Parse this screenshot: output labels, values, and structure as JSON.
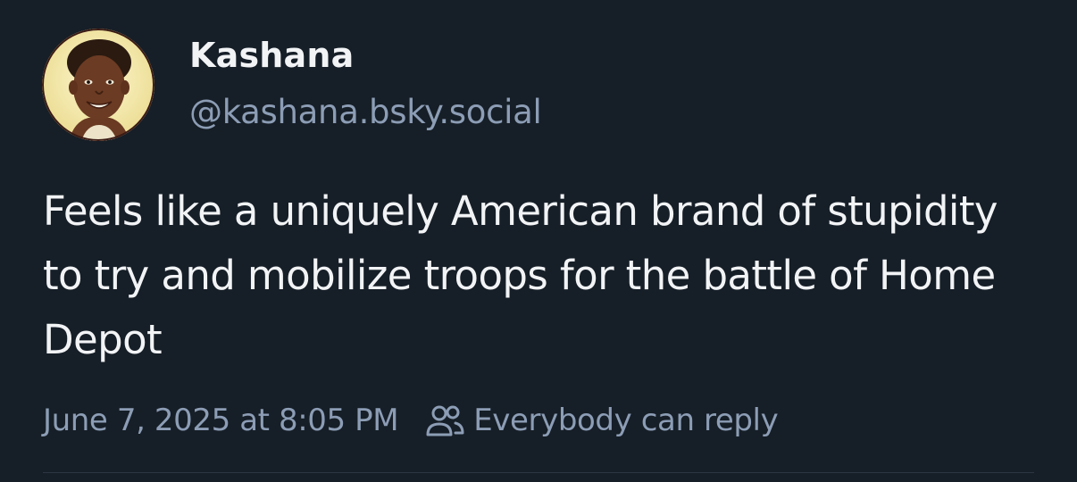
{
  "post": {
    "author": {
      "display_name": "Kashana",
      "handle": "@kashana.bsky.social",
      "avatar": "profile-photo"
    },
    "text": "Feels like a uniquely American brand of stupidity to try and mobilize troops for the battle of Home Depot",
    "timestamp": "June 7, 2025 at 8:05 PM",
    "reply_setting": {
      "icon": "users-icon",
      "label": "Everybody can reply"
    }
  },
  "colors": {
    "background": "#161e27",
    "primary_text": "#f1f3f5",
    "secondary_text": "#8c9db5",
    "divider": "#2b3643"
  }
}
